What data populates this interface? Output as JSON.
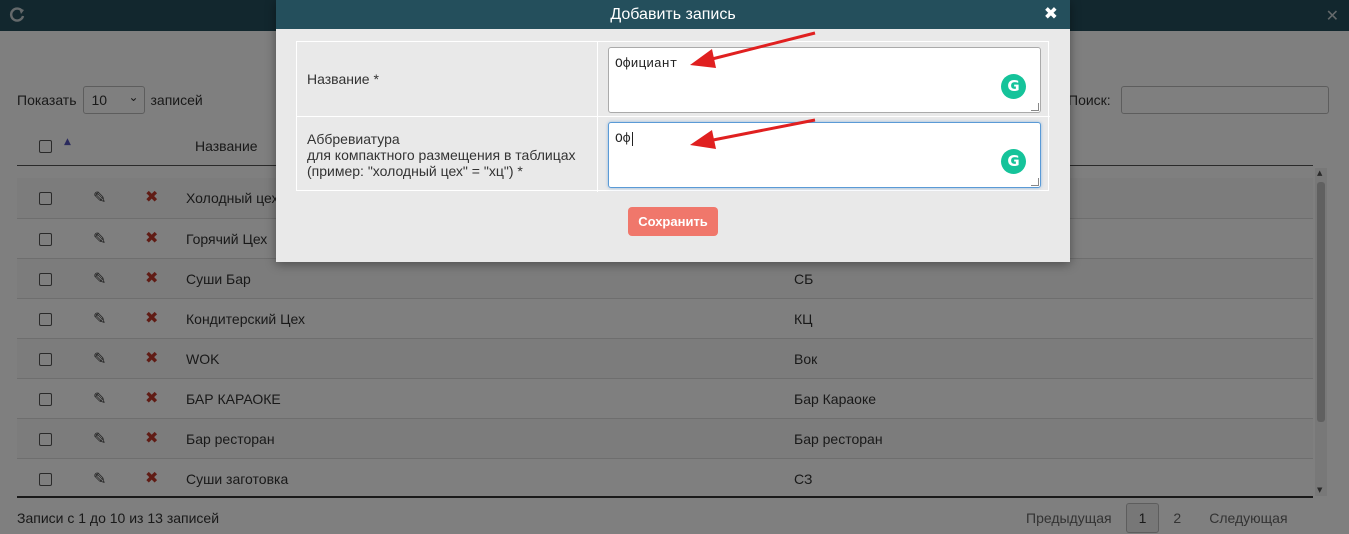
{
  "page": {
    "show_label": "Показать",
    "entries_label": "записей",
    "page_length_value": "10",
    "search_label": "Поиск:",
    "column_name_header": "Название",
    "info_text": "Записи с 1 до 10 из 13 записей",
    "prev_label": "Предыдущая",
    "next_label": "Следующая",
    "pages": [
      "1",
      "2"
    ]
  },
  "rows": [
    {
      "name": "Холодный цех",
      "abbr": ""
    },
    {
      "name": "Горячий Цех",
      "abbr": ""
    },
    {
      "name": "Суши Бар",
      "abbr": "СБ"
    },
    {
      "name": "Кондитерский Цех",
      "abbr": "КЦ"
    },
    {
      "name": "WOK",
      "abbr": "Вок"
    },
    {
      "name": "БАР КАРАОКЕ",
      "abbr": "Бар Караоке"
    },
    {
      "name": "Бар ресторан",
      "abbr": "Бар ресторан"
    },
    {
      "name": "Суши заготовка",
      "abbr": "СЗ"
    }
  ],
  "modal": {
    "title": "Добавить запись",
    "name_label": "Название *",
    "name_value": "Официант",
    "abbr_label_1": "Аббревиатура",
    "abbr_label_2": "для компактного размещения в таблицах",
    "abbr_label_3": "(пример: \"холодный цех\" = \"хц\") *",
    "abbr_value": "Оф",
    "save_label": "Сохранить"
  },
  "colors": {
    "header_bg": "#244f5c",
    "save_button": "#f0776b",
    "delete_icon": "#c0392b",
    "grammarly": "#15c39a",
    "annotation_arrow": "#e02020"
  }
}
